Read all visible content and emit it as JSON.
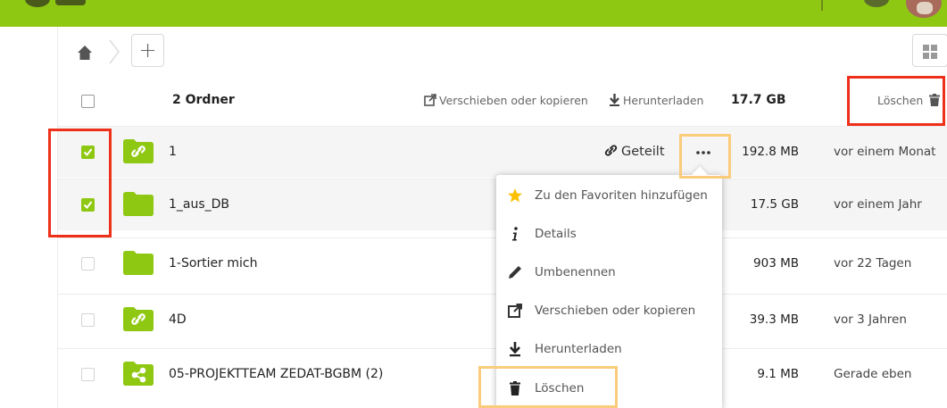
{
  "breadcrumb": {
    "home_icon": "home-icon",
    "new_button_label": "+"
  },
  "header": {
    "count": "2 Ordner",
    "move_copy": "Verschieben oder kopieren",
    "download": "Herunterladen",
    "total_size": "17.7 GB",
    "delete": "Löschen"
  },
  "files": [
    {
      "name": "1",
      "type": "shared-link-folder",
      "shared_label": "Geteilt",
      "size": "192.8 MB",
      "modified": "vor einem Monat",
      "checked": true
    },
    {
      "name": "1_aus_DB",
      "type": "folder",
      "size": "17.5 GB",
      "modified": "vor einem Jahr",
      "checked": true
    },
    {
      "name": "1-Sortier mich",
      "type": "folder",
      "size": "903 MB",
      "modified": "vor 22 Tagen",
      "checked": false
    },
    {
      "name": "4D",
      "type": "shared-link-folder",
      "size": "39.3 MB",
      "modified": "vor 3 Jahren",
      "checked": false
    },
    {
      "name": "05-PROJEKTTEAM ZEDAT-BGBM (2)",
      "type": "shared-folder",
      "size": "9.1 MB",
      "modified": "Gerade eben",
      "checked": false
    }
  ],
  "context_menu": [
    {
      "label": "Zu den Favoriten hinzufügen",
      "icon": "star-icon"
    },
    {
      "label": "Details",
      "icon": "info-icon"
    },
    {
      "label": "Umbenennen",
      "icon": "pencil-icon"
    },
    {
      "label": "Verschieben oder kopieren",
      "icon": "external-icon"
    },
    {
      "label": "Herunterladen",
      "icon": "download-icon"
    },
    {
      "label": "Löschen",
      "icon": "trash-icon"
    }
  ],
  "colors": {
    "brand": "#8fc812",
    "highlight_red": "#ee2f1a",
    "highlight_yellow": "#fbcc7b"
  }
}
